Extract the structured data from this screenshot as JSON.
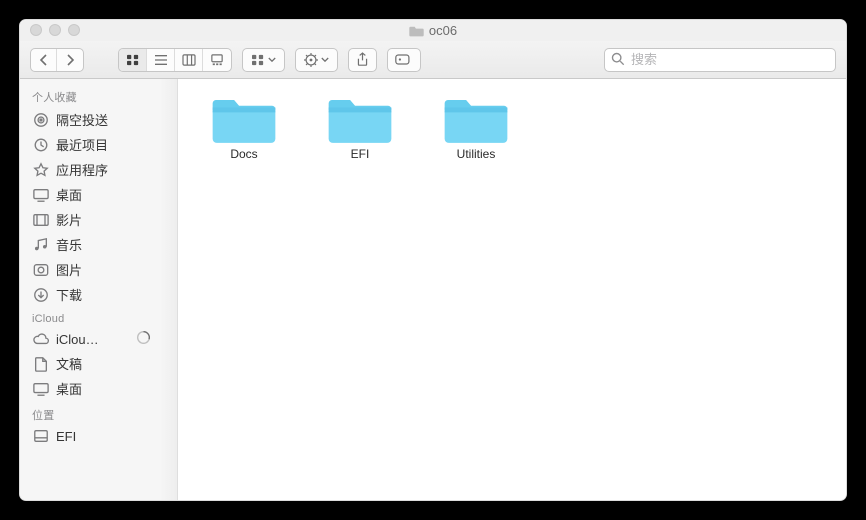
{
  "window": {
    "title": "oc06"
  },
  "search": {
    "placeholder": "搜索"
  },
  "sidebar": {
    "sections": [
      {
        "title": "个人收藏",
        "items": [
          {
            "icon": "airdrop",
            "label": "隔空投送"
          },
          {
            "icon": "recents",
            "label": "最近项目"
          },
          {
            "icon": "apps",
            "label": "应用程序"
          },
          {
            "icon": "desktop",
            "label": "桌面"
          },
          {
            "icon": "movies",
            "label": "影片"
          },
          {
            "icon": "music",
            "label": "音乐"
          },
          {
            "icon": "pictures",
            "label": "图片"
          },
          {
            "icon": "downloads",
            "label": "下载"
          }
        ]
      },
      {
        "title": "iCloud",
        "items": [
          {
            "icon": "cloud",
            "label": "iClou…",
            "badge": "progress"
          },
          {
            "icon": "doc",
            "label": "文稿"
          },
          {
            "icon": "desktop",
            "label": "桌面"
          }
        ]
      },
      {
        "title": "位置",
        "items": [
          {
            "icon": "disk",
            "label": "EFI"
          }
        ]
      }
    ]
  },
  "folders": [
    {
      "name": "Docs"
    },
    {
      "name": "EFI"
    },
    {
      "name": "Utilities"
    }
  ]
}
